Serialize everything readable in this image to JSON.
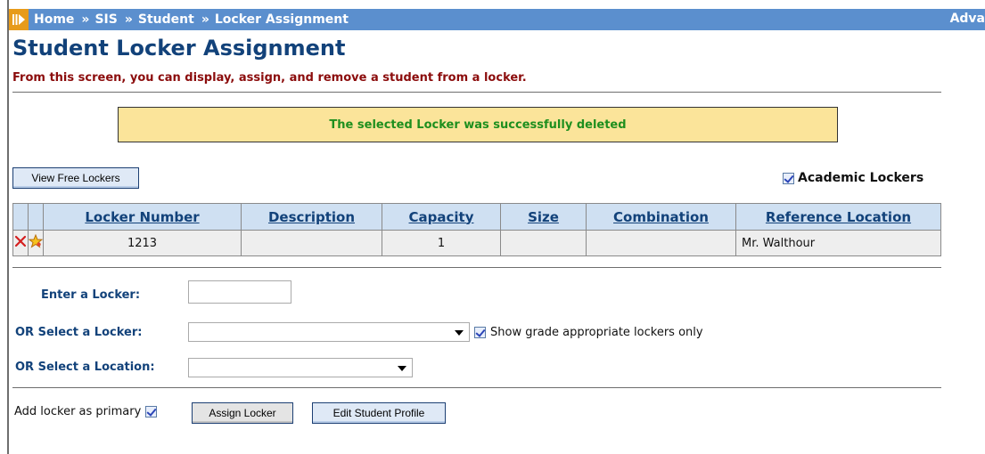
{
  "breadcrumb": {
    "items": [
      "Home",
      "SIS",
      "Student",
      "Locker Assignment"
    ],
    "separator": "»",
    "right_text": "Adva"
  },
  "page": {
    "title": "Student Locker Assignment",
    "subtitle": "From this screen, you can display, assign, and remove a student from a locker."
  },
  "message": {
    "text": "The selected Locker was successfully deleted"
  },
  "toolbar": {
    "view_free_label": "View Free Lockers",
    "academic_label": "Academic Lockers",
    "academic_checked": true
  },
  "table": {
    "headers": [
      "Locker Number",
      "Description",
      "Capacity",
      "Size",
      "Combination",
      "Reference Location"
    ],
    "rows": [
      {
        "locker_number": "1213",
        "description": "",
        "capacity": "1",
        "size": "",
        "combination": "",
        "reference_location": "Mr. Walthour"
      }
    ]
  },
  "form": {
    "enter_locker_label": "Enter a Locker:",
    "enter_locker_value": "",
    "select_locker_label": "OR Select a Locker:",
    "select_locker_value": "",
    "grade_only_label": "Show grade appropriate lockers only",
    "grade_only_checked": true,
    "select_location_label": "OR Select a Location:",
    "select_location_value": ""
  },
  "actions": {
    "add_primary_label": "Add locker as primary",
    "add_primary_checked": true,
    "assign_label": "Assign Locker",
    "edit_profile_label": "Edit Student Profile"
  },
  "colors": {
    "breadcrumb_bg": "#5b8fce",
    "title": "#12427a",
    "subtitle": "#8b0c0c",
    "message_bg": "#fbe49a",
    "message_text": "#1e8f1e",
    "table_header_bg": "#cfe0f2"
  }
}
